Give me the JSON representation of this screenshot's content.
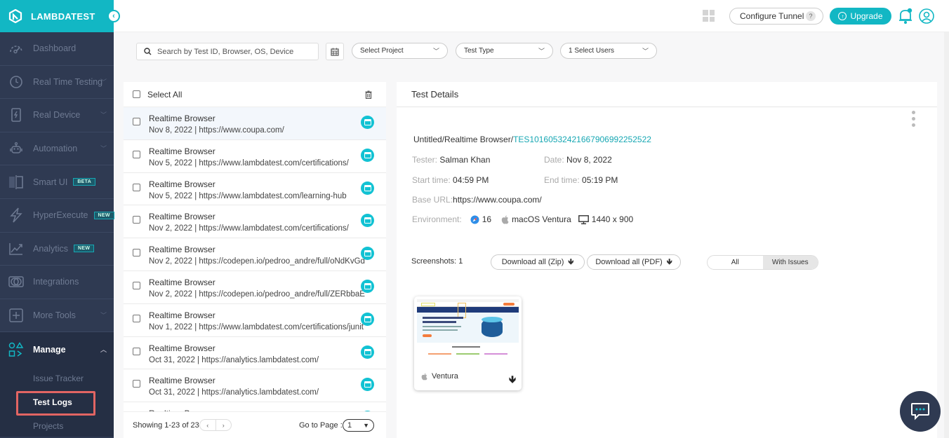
{
  "brand": {
    "name": "LAMBDATEST",
    "accent": "#12b7c4"
  },
  "sidebar": {
    "items": [
      {
        "label": "Dashboard",
        "icon": "dashboard-icon",
        "chevron": false
      },
      {
        "label": "Real Time Testing",
        "icon": "realtime-icon",
        "chevron": true
      },
      {
        "label": "Real Device",
        "icon": "device-icon",
        "chevron": true
      },
      {
        "label": "Automation",
        "icon": "robot-icon",
        "chevron": true
      },
      {
        "label": "Smart UI",
        "icon": "smartui-icon",
        "badge": "BETA"
      },
      {
        "label": "HyperExecute",
        "icon": "bolt-icon",
        "badge": "NEW"
      },
      {
        "label": "Analytics",
        "icon": "chart-icon",
        "badge": "NEW"
      },
      {
        "label": "Integrations",
        "icon": "integrations-icon",
        "chevron": false
      },
      {
        "label": "More Tools",
        "icon": "plus-box-icon",
        "chevron": true
      }
    ],
    "manage": {
      "label": "Manage",
      "icon": "manage-icon"
    },
    "sub_items": [
      "Issue Tracker",
      "Test Logs",
      "Projects"
    ],
    "active_sub": "Test Logs"
  },
  "topbar": {
    "configure_tunnel": "Configure Tunnel",
    "help": "?",
    "upgrade": "Upgrade"
  },
  "filters": {
    "search_placeholder": "Search by Test ID, Browser, OS, Device",
    "project": "Select Project",
    "test_type": "Test Type",
    "users": "1 Select Users"
  },
  "list": {
    "select_all": "Select All",
    "rows": [
      {
        "title": "Realtime Browser",
        "sub": "Nov 8, 2022 | https://www.coupa.com/",
        "selected": true
      },
      {
        "title": "Realtime Browser",
        "sub": "Nov 5, 2022 | https://www.lambdatest.com/certifications/"
      },
      {
        "title": "Realtime Browser",
        "sub": "Nov 5, 2022 | https://www.lambdatest.com/learning-hub"
      },
      {
        "title": "Realtime Browser",
        "sub": "Nov 2, 2022 | https://www.lambdatest.com/certifications/"
      },
      {
        "title": "Realtime Browser",
        "sub": "Nov 2, 2022 | https://codepen.io/pedroo_andre/full/oNdKvGd"
      },
      {
        "title": "Realtime Browser",
        "sub": "Nov 2, 2022 | https://codepen.io/pedroo_andre/full/ZERbbaE"
      },
      {
        "title": "Realtime Browser",
        "sub": "Nov 1, 2022 | https://www.lambdatest.com/certifications/junit"
      },
      {
        "title": "Realtime Browser",
        "sub": "Oct 31, 2022 | https://analytics.lambdatest.com/"
      },
      {
        "title": "Realtime Browser",
        "sub": "Oct 31, 2022 | https://analytics.lambdatest.com/"
      },
      {
        "title": "Realtime Browser",
        "sub": ""
      }
    ],
    "showing": "Showing 1-23 of 23",
    "prev": "‹",
    "next": "›",
    "goto_label": "Go to Page :",
    "goto_value": "1"
  },
  "details": {
    "title": "Test Details",
    "path_prefix": "Untitled/Realtime Browser/",
    "test_id": "TES10160532421667906992252522",
    "tester_label": "Tester:",
    "tester": "Salman Khan",
    "date_label": "Date:",
    "date": "Nov 8, 2022",
    "start_label": "Start time:",
    "start": "04:59 PM",
    "end_label": "End time:",
    "end": "05:19 PM",
    "base_url_label": "Base URL:",
    "base_url": "https://www.coupa.com/",
    "env_label": "Environment:",
    "browser_version": "16",
    "os": "macOS Ventura",
    "resolution": "1440 x 900",
    "screenshots_label": "Screenshots: 1",
    "download_zip": "Download all (Zip)",
    "download_pdf": "Download all (PDF)",
    "seg_all": "All",
    "seg_issues": "With Issues",
    "thumb_caption": "Ventura"
  }
}
